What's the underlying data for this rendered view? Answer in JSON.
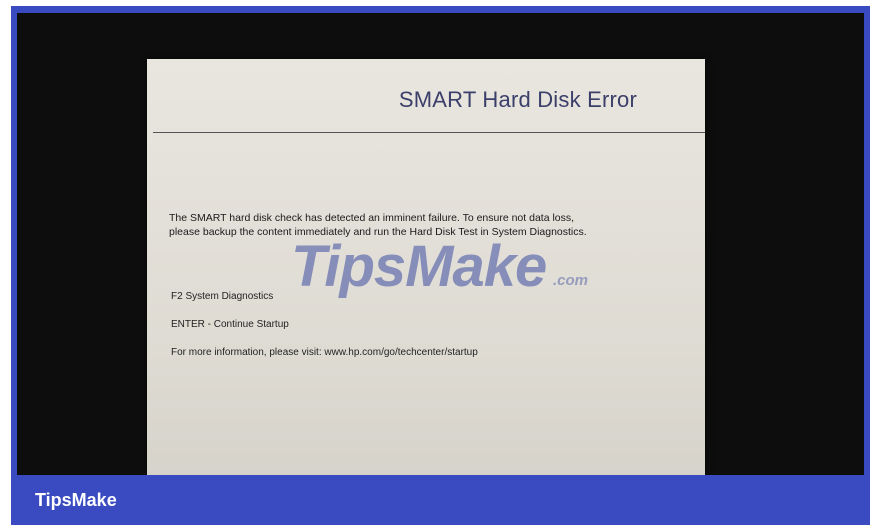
{
  "screen": {
    "title": "SMART Hard Disk Error",
    "message_line_1": "The SMART hard disk check has detected an imminent failure.  To ensure not data loss,",
    "message_line_2": "please backup the content immediately and run the Hard Disk Test in System Diagnostics.",
    "option_1": "F2 System Diagnostics",
    "option_2": "ENTER - Continue Startup",
    "option_3": "For more information, please visit:  www.hp.com/go/techcenter/startup"
  },
  "watermark": {
    "text": "TipsMake",
    "suffix": ".com"
  },
  "footer": {
    "brand": "TipsMake"
  },
  "colors": {
    "frame_blue": "#3a4bc2",
    "screen_bg": "#e4e1da",
    "title_text": "#3b3f6a"
  }
}
